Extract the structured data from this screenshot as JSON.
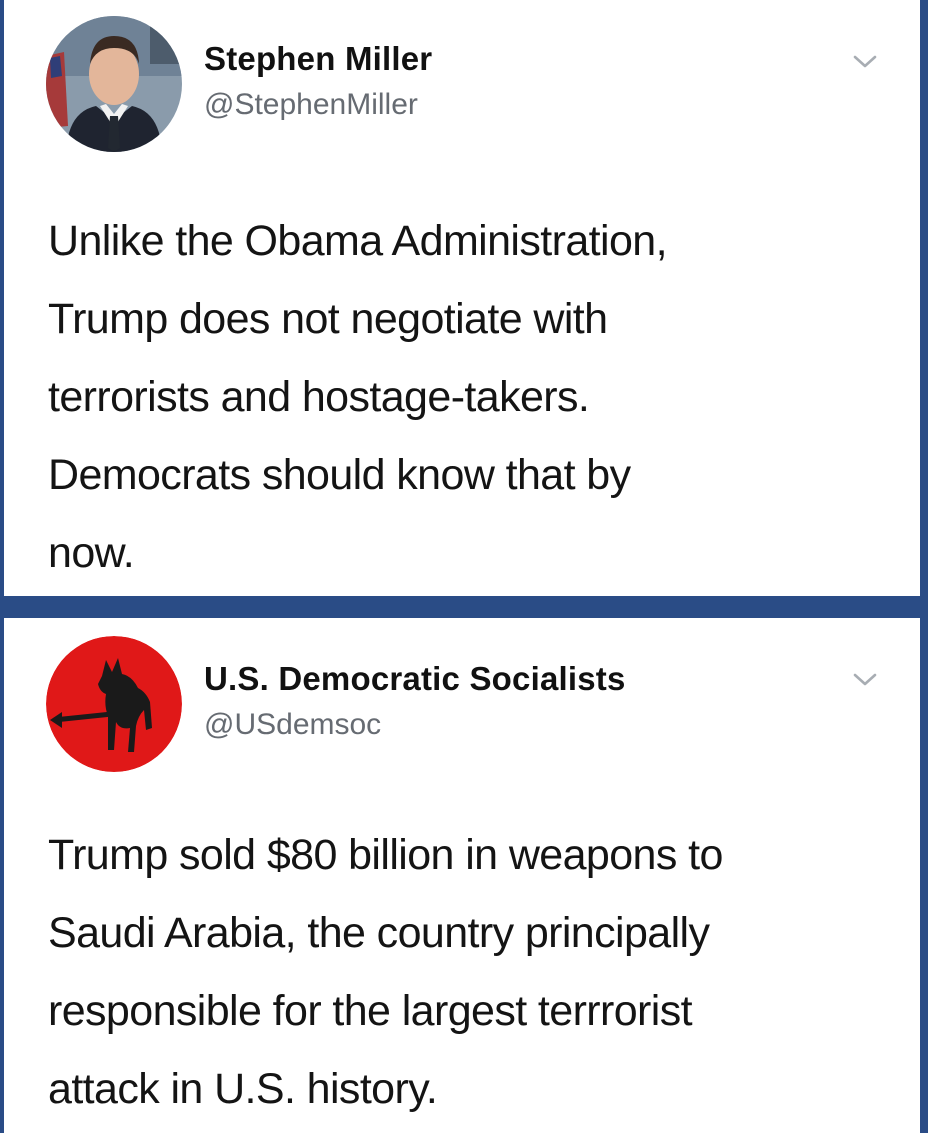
{
  "tweets": [
    {
      "display_name": "Stephen Miller",
      "handle": "@StephenMiller",
      "text": "Unlike the Obama Administration,\nTrump does not negotiate with\nterrorists and hostage-takers.\nDemocrats should know that by\nnow.",
      "avatar_icon": "profile-photo",
      "menu_icon": "chevron-down-icon"
    },
    {
      "display_name": "U.S. Democratic Socialists",
      "handle": "@USdemsoc",
      "text": "Trump sold $80 billion in weapons to\nSaudi Arabia, the country principally\nresponsible for the largest terrrorist\nattack in U.S. history.",
      "avatar_icon": "donkey-logo-icon",
      "menu_icon": "chevron-down-icon"
    }
  ],
  "colors": {
    "background": "#2a4c86",
    "card": "#ffffff",
    "text": "#141414",
    "handle": "#666b72",
    "chevron": "#a8adb3",
    "logo_red": "#e01818"
  }
}
